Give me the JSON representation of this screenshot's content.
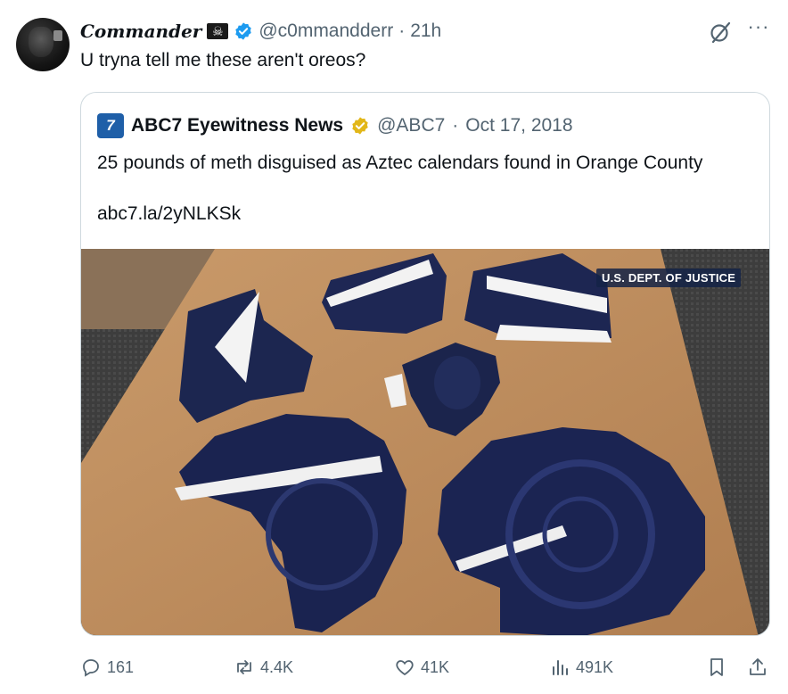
{
  "author": {
    "display_name": "Commander",
    "handle": "@c0mmandderr",
    "time": "21h",
    "dot": "·",
    "flag_glyph": "☠"
  },
  "tweet_text": "U tryna tell me these aren't oreos?",
  "more_glyph": "···",
  "quoted": {
    "logo_text": "7",
    "name": "ABC7 Eyewitness News",
    "handle": "@ABC7",
    "dot": "·",
    "date": "Oct 17, 2018",
    "text": "25 pounds of meth disguised as Aztec calendars found in Orange County",
    "link": "abc7.la/2yNLKSk",
    "media_watermark": "U.S. DEPT. OF JUSTICE"
  },
  "actions": {
    "replies": "161",
    "reposts": "4.4K",
    "likes": "41K",
    "views": "491K"
  },
  "colors": {
    "text": "#0f1419",
    "secondary": "#536471",
    "verified_blue": "#1d9bf0",
    "verified_gold": "#e2b719",
    "border": "#cfd9de",
    "abc_blue": "#1f5fa8"
  },
  "icons": [
    "flag-icon",
    "verified-badge-icon",
    "grok-icon",
    "more-icon",
    "abc7-logo",
    "gold-badge-icon",
    "reply-icon",
    "repost-icon",
    "like-icon",
    "views-icon",
    "bookmark-icon",
    "share-icon"
  ]
}
